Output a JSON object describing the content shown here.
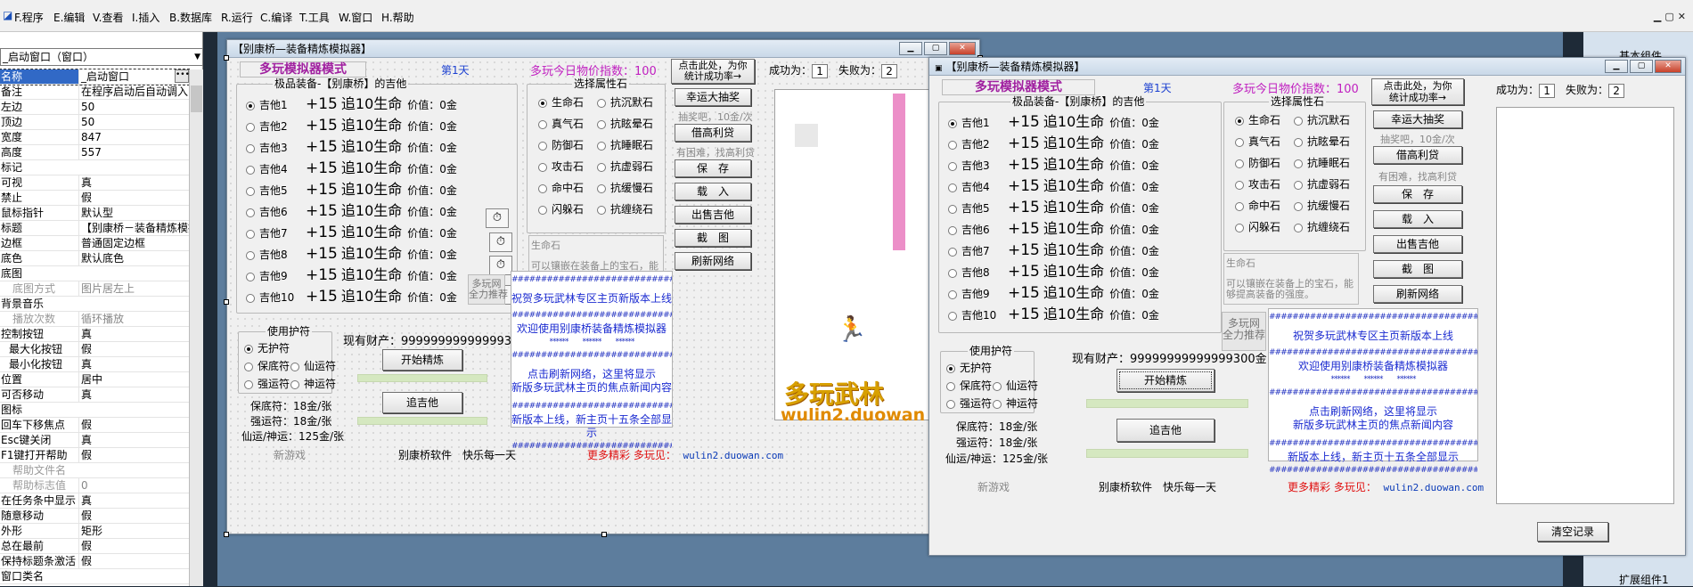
{
  "menu": [
    "F.程序",
    "E.编辑",
    "V.查看",
    "I.插入",
    "B.数据库",
    "R.运行",
    "C.编译",
    "T.工具",
    "W.窗口",
    "H.帮助"
  ],
  "prop_panel": {
    "dropdown": "_启动窗口（窗口）",
    "rows": [
      {
        "n": "名称",
        "v": "_启动窗口"
      },
      {
        "n": "备注",
        "v": "在程序启动后自动调入"
      },
      {
        "n": "左边",
        "v": "50"
      },
      {
        "n": "顶边",
        "v": "50"
      },
      {
        "n": "宽度",
        "v": "847"
      },
      {
        "n": "高度",
        "v": "557"
      },
      {
        "n": "标记",
        "v": ""
      },
      {
        "n": "可视",
        "v": "真"
      },
      {
        "n": "禁止",
        "v": "假"
      },
      {
        "n": "鼠标指针",
        "v": "默认型"
      },
      {
        "n": "标题",
        "v": "【别康桥－装备精炼模拟"
      },
      {
        "n": "边框",
        "v": "普通固定边框"
      },
      {
        "n": "底色",
        "v": "默认底色"
      },
      {
        "n": "底图",
        "v": ""
      },
      {
        "n": "底图方式",
        "v": "图片居左上"
      },
      {
        "n": "背景音乐",
        "v": ""
      },
      {
        "n": "播放次数",
        "v": "循环播放"
      },
      {
        "n": "控制按钮",
        "v": "真"
      },
      {
        "n": "最大化按钮",
        "v": "假"
      },
      {
        "n": "最小化按钮",
        "v": "真"
      },
      {
        "n": "位置",
        "v": "居中"
      },
      {
        "n": "可否移动",
        "v": "真"
      },
      {
        "n": "图标",
        "v": ""
      },
      {
        "n": "回车下移焦点",
        "v": "假"
      },
      {
        "n": "Esc键关闭",
        "v": "真"
      },
      {
        "n": "F1键打开帮助",
        "v": "假"
      },
      {
        "n": "帮助文件名",
        "v": ""
      },
      {
        "n": "帮助标志值",
        "v": "0"
      },
      {
        "n": "在任务条中显示",
        "v": "真"
      },
      {
        "n": "随意移动",
        "v": "假"
      },
      {
        "n": "外形",
        "v": "矩形"
      },
      {
        "n": "总在最前",
        "v": "假"
      },
      {
        "n": "保持标题条激活",
        "v": "假"
      },
      {
        "n": "窗口类名",
        "v": ""
      }
    ]
  },
  "right_panel": {
    "top": "基本组件",
    "bottom": "扩展组件1"
  },
  "app": {
    "title": "【别康桥—装备精炼模拟器】",
    "mode": "多玩模拟器模式",
    "day": "第1天",
    "price_label": "多玩今日物价指数：",
    "price": "100",
    "equip_group": "极品装备-【别康桥】的吉他",
    "items": [
      {
        "name": "吉他1",
        "plus": "+15",
        "desc": "追10生命",
        "price": "价值：0金"
      },
      {
        "name": "吉他2",
        "plus": "+15",
        "desc": "追10生命",
        "price": "价值：0金"
      },
      {
        "name": "吉他3",
        "plus": "+15",
        "desc": "追10生命",
        "price": "价值：0金"
      },
      {
        "name": "吉他4",
        "plus": "+15",
        "desc": "追10生命",
        "price": "价值：0金"
      },
      {
        "name": "吉他5",
        "plus": "+15",
        "desc": "追10生命",
        "price": "价值：0金"
      },
      {
        "name": "吉他6",
        "plus": "+15",
        "desc": "追10生命",
        "price": "价值：0金"
      },
      {
        "name": "吉他7",
        "plus": "+15",
        "desc": "追10生命",
        "price": "价值：0金"
      },
      {
        "name": "吉他8",
        "plus": "+15",
        "desc": "追10生命",
        "price": "价值：0金"
      },
      {
        "name": "吉他9",
        "plus": "+15",
        "desc": "追10生命",
        "price": "价值：0金"
      },
      {
        "name": "吉他10",
        "plus": "+15",
        "desc": "追10生命",
        "price": "价值：0金"
      }
    ],
    "stone_group": "选择属性石",
    "stones": [
      "生命石",
      "抗沉默石",
      "真气石",
      "抗眩晕石",
      "防御石",
      "抗睡眠石",
      "攻击石",
      "抗虚弱石",
      "命中石",
      "抗缓慢石",
      "闪躲石",
      "抗缠绕石"
    ],
    "stone_name": "生命石",
    "stone_desc": "可以镶嵌在装备上的宝石，能够提高装备的强度。",
    "buttons": {
      "stats": "点击此处，为你\n统计成功率→",
      "lottery": "幸运大抽奖",
      "lottery_note": "抽奖吧，10金/次",
      "loan": "借高利贷",
      "loan_note": "有困难，找高利贷",
      "save": "保　存",
      "load": "载　入",
      "sell": "出售吉他",
      "screenshot": "截　图",
      "refresh": "刷新网络",
      "refine": "开始精炼",
      "chase": "追吉他",
      "clear": "清空记录"
    },
    "success_label": "成功为：",
    "success": "1",
    "fail_label": "失败为：",
    "fail": "2",
    "protect_group": "使用护符",
    "protects": [
      "无护符",
      "保底符",
      "仙运符",
      "强运符",
      "神运符"
    ],
    "assets_label": "现有财产：",
    "assets": "99999999999999300金",
    "prices": [
      "保底符：18金/张",
      "强运符：18金/张",
      "仙运/神运：125金/张"
    ],
    "duowan_side": "多玩网\n全力推荐",
    "news": {
      "hash": "########################################",
      "l1": "祝贺多玩武林专区主页新版本上线",
      "l2": "欢迎使用别康桥装备精炼模拟器",
      "stars": "******　　******　　******",
      "l3": "点击刷新网络，这里将显示",
      "l4": "新版多玩武林主页的焦点新闻内容",
      "l5": "新版本上线，新主页十五条全部显示"
    },
    "footer": {
      "newgame": "新游戏",
      "software": "别康桥软件　快乐每一天",
      "more": "更多精彩",
      "site_label": "多玩见：",
      "site": "wulin2.duowan.com"
    },
    "logo": "多玩武林",
    "logo_en": "wulin2.duowan"
  }
}
